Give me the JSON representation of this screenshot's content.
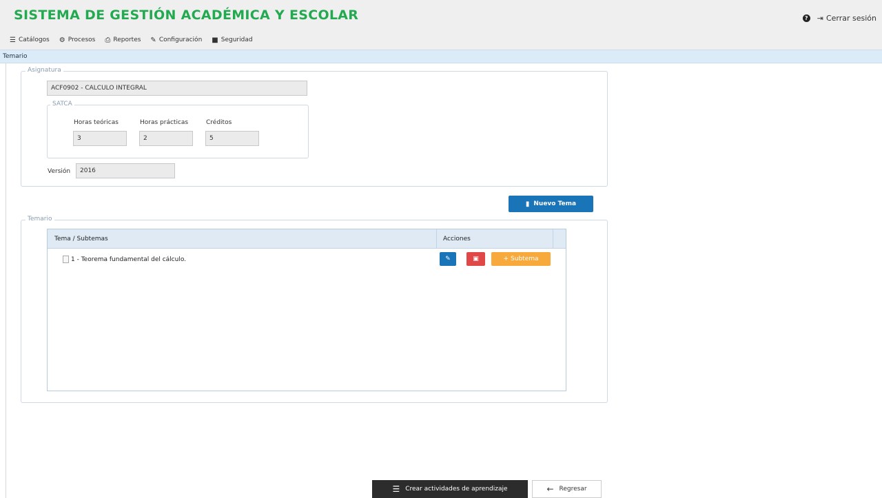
{
  "app": {
    "title": "SISTEMA DE GESTIÓN ACADÉMICA Y ESCOLAR"
  },
  "topbar": {
    "logout_label": "Cerrar sesión"
  },
  "menu": [
    {
      "label": "Catálogos",
      "icon": "list-icon"
    },
    {
      "label": "Procesos",
      "icon": "gear-icon"
    },
    {
      "label": "Reportes",
      "icon": "printer-icon"
    },
    {
      "label": "Configuración",
      "icon": "wrench-icon"
    },
    {
      "label": "Seguridad",
      "icon": "lock-icon"
    }
  ],
  "breadcrumb": "Temario",
  "asignatura": {
    "legend": "Asignatura",
    "value": "ACF0902 - CALCULO INTEGRAL",
    "satca": {
      "legend": "SATCA",
      "teoricas_label": "Horas teóricas",
      "teoricas_value": "3",
      "practicas_label": "Horas prácticas",
      "practicas_value": "2",
      "creditos_label": "Créditos",
      "creditos_value": "5"
    },
    "version_label": "Versión",
    "version_value": "2016"
  },
  "nuevo_tema_label": "Nuevo Tema",
  "temario": {
    "legend": "Temario",
    "col_tema": "Tema / Subtemas",
    "col_acciones": "Acciones",
    "rows": [
      {
        "text": "1 - Teorema fundamental del cálculo.",
        "subtema_label": "Subtema"
      }
    ]
  },
  "footer": {
    "crear_label": "Crear actividades de aprendizaje",
    "regresar_label": "Regresar"
  },
  "colors": {
    "brand": "#23a94f",
    "primary": "#1a74b8",
    "danger": "#e04848",
    "warning": "#f7a93c",
    "dark": "#2c2c2c"
  }
}
